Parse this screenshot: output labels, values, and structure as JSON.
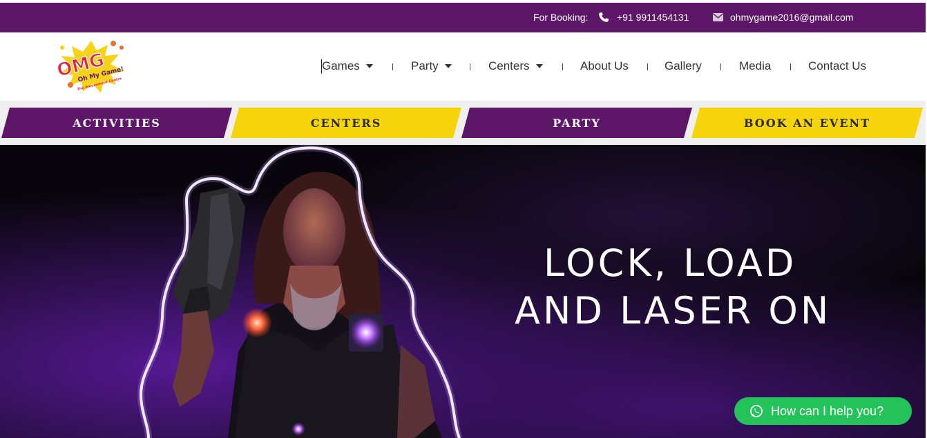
{
  "topbar": {
    "booking_label": "For Booking:",
    "phone": "+91 9911454131",
    "email": "ohmygame2016@gmail.com",
    "phone_icon": "phone-icon",
    "email_icon": "envelope-icon"
  },
  "logo": {
    "main": "OMG",
    "tagline": "Oh My Game!",
    "sub": "The Amusement Centre"
  },
  "nav": {
    "items": [
      {
        "label": "Games",
        "dropdown": true
      },
      {
        "label": "Party",
        "dropdown": true
      },
      {
        "label": "Centers",
        "dropdown": true
      },
      {
        "label": "About Us",
        "dropdown": false
      },
      {
        "label": "Gallery",
        "dropdown": false
      },
      {
        "label": "Media",
        "dropdown": false
      },
      {
        "label": "Contact Us",
        "dropdown": false
      }
    ]
  },
  "tabs": [
    {
      "label": "ACTIVITIES",
      "color": "#5e1668"
    },
    {
      "label": "CENTERS",
      "color": "#f5d40c"
    },
    {
      "label": "PARTY",
      "color": "#5e1668"
    },
    {
      "label": "BOOK AN EVENT",
      "color": "#f5d40c"
    }
  ],
  "hero": {
    "line1": "LOCK, LOAD",
    "line2": "AND LASER ON"
  },
  "chat": {
    "label": "How can I help you?",
    "icon": "whatsapp-icon"
  },
  "colors": {
    "brand_purple": "#5e1668",
    "brand_yellow": "#f5d40c",
    "whatsapp_green": "#23c35a"
  }
}
